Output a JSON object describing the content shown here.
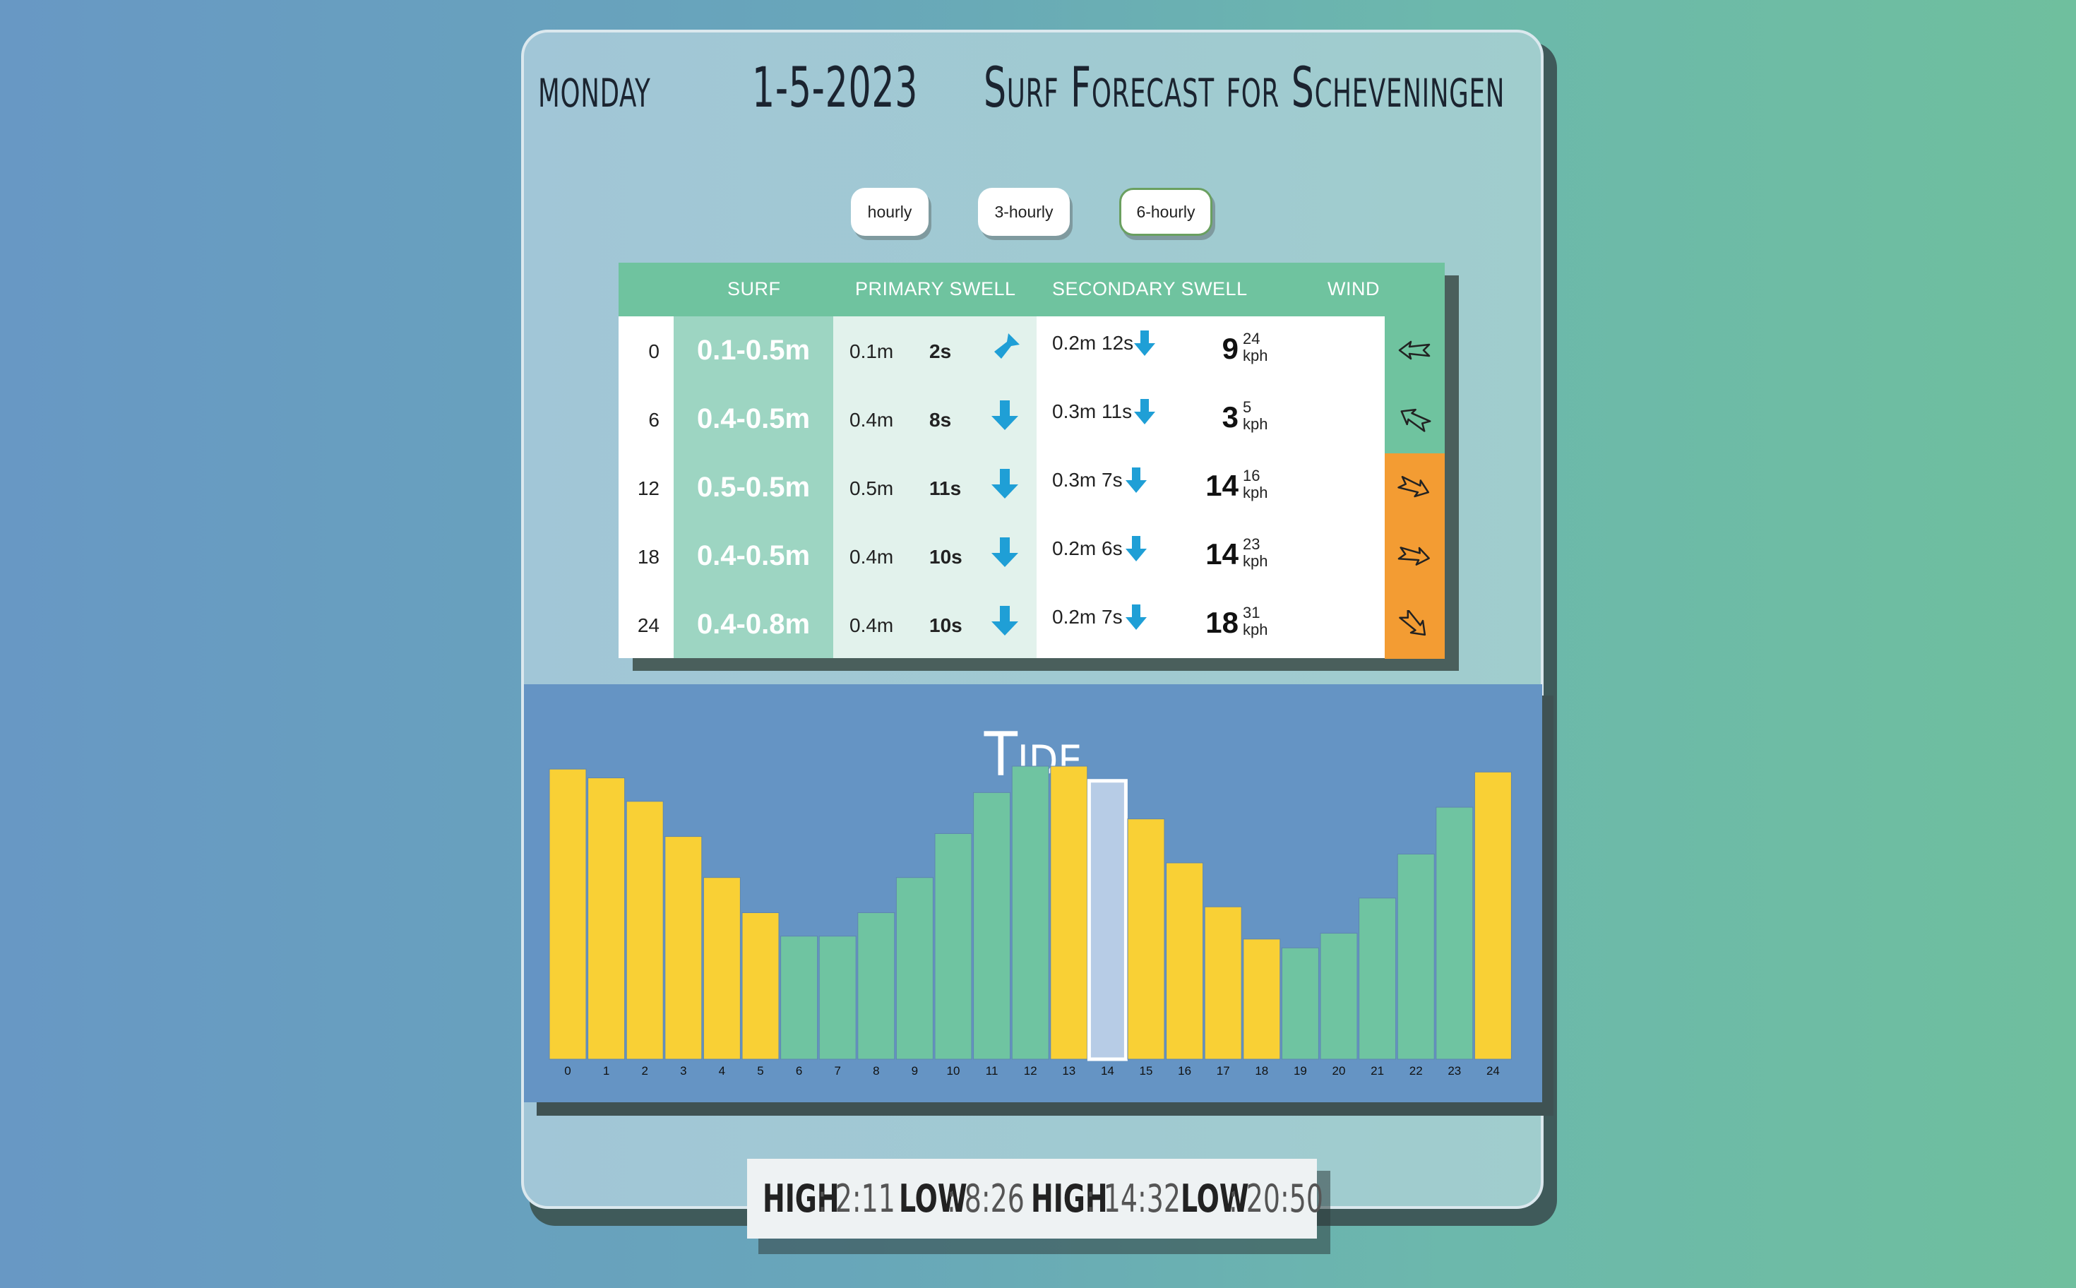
{
  "header": {
    "day": "MONDAY",
    "date": "1-5-2023",
    "title": "Surf Forecast for Scheveningen"
  },
  "view_buttons": {
    "hourly": "hourly",
    "three_hourly": "3-hourly",
    "six_hourly": "6-hourly",
    "selected": "6-hourly"
  },
  "table": {
    "headers": {
      "surf": "SURF",
      "primary": "PRIMARY SWELL",
      "secondary": "SECONDARY SWELL",
      "wind": "WIND"
    },
    "rows": [
      {
        "hour": "0",
        "surf": "0.1-0.5m",
        "p_height": "0.1m",
        "p_period": "2s",
        "s_height": "0.2m",
        "s_period": "12s",
        "wind": "9",
        "gust": "24",
        "unit": "kph",
        "wind_color": "#6fc39f"
      },
      {
        "hour": "6",
        "surf": "0.4-0.5m",
        "p_height": "0.4m",
        "p_period": "8s",
        "s_height": "0.3m",
        "s_period": "11s",
        "wind": "3",
        "gust": "5",
        "unit": "kph",
        "wind_color": "#6fc39f"
      },
      {
        "hour": "12",
        "surf": "0.5-0.5m",
        "p_height": "0.5m",
        "p_period": "11s",
        "s_height": "0.3m",
        "s_period": "7s",
        "wind": "14",
        "gust": "16",
        "unit": "kph",
        "wind_color": "#f39c33"
      },
      {
        "hour": "18",
        "surf": "0.4-0.5m",
        "p_height": "0.4m",
        "p_period": "10s",
        "s_height": "0.2m",
        "s_period": "6s",
        "wind": "14",
        "gust": "23",
        "unit": "kph",
        "wind_color": "#f39c33"
      },
      {
        "hour": "24",
        "surf": "0.4-0.8m",
        "p_height": "0.4m",
        "p_period": "10s",
        "s_height": "0.2m",
        "s_period": "7s",
        "wind": "18",
        "gust": "31",
        "unit": "kph",
        "wind_color": "#f39c33"
      }
    ]
  },
  "colors": {
    "yellow": "#f9d035",
    "green": "#6fc4a1",
    "selected": "#b7cce6",
    "panel": "#6594c4"
  },
  "chart_data": {
    "type": "bar",
    "title": "Tide",
    "categories": [
      "0",
      "1",
      "2",
      "3",
      "4",
      "5",
      "6",
      "7",
      "8",
      "9",
      "10",
      "11",
      "12",
      "13",
      "14",
      "15",
      "16",
      "17",
      "18",
      "19",
      "20",
      "21",
      "22",
      "23",
      "24"
    ],
    "values": [
      0.99,
      0.96,
      0.88,
      0.76,
      0.62,
      0.5,
      0.42,
      0.42,
      0.5,
      0.62,
      0.77,
      0.91,
      1.0,
      1.0,
      0.95,
      0.82,
      0.67,
      0.52,
      0.41,
      0.38,
      0.43,
      0.55,
      0.7,
      0.86,
      0.98
    ],
    "bar_colors": [
      "yellow",
      "yellow",
      "yellow",
      "yellow",
      "yellow",
      "yellow",
      "green",
      "green",
      "green",
      "green",
      "green",
      "green",
      "green",
      "yellow",
      "selected",
      "yellow",
      "yellow",
      "yellow",
      "yellow",
      "green",
      "green",
      "green",
      "green",
      "green",
      "yellow"
    ],
    "selected_hour": "14",
    "ylim": [
      0,
      1
    ]
  },
  "tides": [
    {
      "label": "HIGH",
      "time": ": 2:11"
    },
    {
      "label": "LOW",
      "time": ": 8:26"
    },
    {
      "label": "HIGH",
      "time": ": 14:32"
    },
    {
      "label": "LOW",
      "time": ": 20:50"
    }
  ]
}
